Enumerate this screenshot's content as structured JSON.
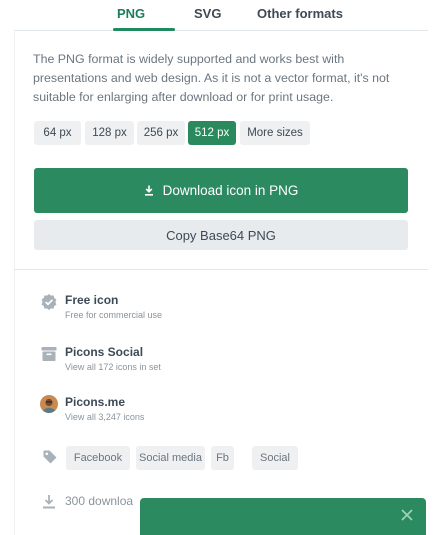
{
  "tabs": [
    {
      "label": "PNG",
      "active": true
    },
    {
      "label": "SVG",
      "active": false
    },
    {
      "label": "Other formats",
      "active": false
    }
  ],
  "description": "The PNG format is widely supported and works best with presentations and web design. As it is not a vector format, it's not suitable for enlarging after download or for print usage.",
  "sizes": [
    {
      "label": "64 px",
      "active": false
    },
    {
      "label": "128 px",
      "active": false
    },
    {
      "label": "256 px",
      "active": false
    },
    {
      "label": "512 px",
      "active": true
    },
    {
      "label": "More sizes",
      "active": false
    }
  ],
  "download_button": "Download icon in PNG",
  "copy_button": "Copy Base64 PNG",
  "license": {
    "title": "Free icon",
    "sub": "Free for commercial use",
    "icon": "badge-check-icon"
  },
  "set": {
    "title": "Picons Social",
    "sub": "View all 172 icons in set",
    "icon": "archive-box-icon"
  },
  "author": {
    "title": "Picons.me",
    "sub": "View all 3,247 icons",
    "icon": "avatar"
  },
  "tags": [
    "Facebook",
    "Social media",
    "Fb",
    "Social"
  ],
  "downloads": "300 downloa",
  "colors": {
    "accent": "#2b8a5f",
    "active_tab": "#1a7f58",
    "chip_bg": "#eef0f2"
  }
}
